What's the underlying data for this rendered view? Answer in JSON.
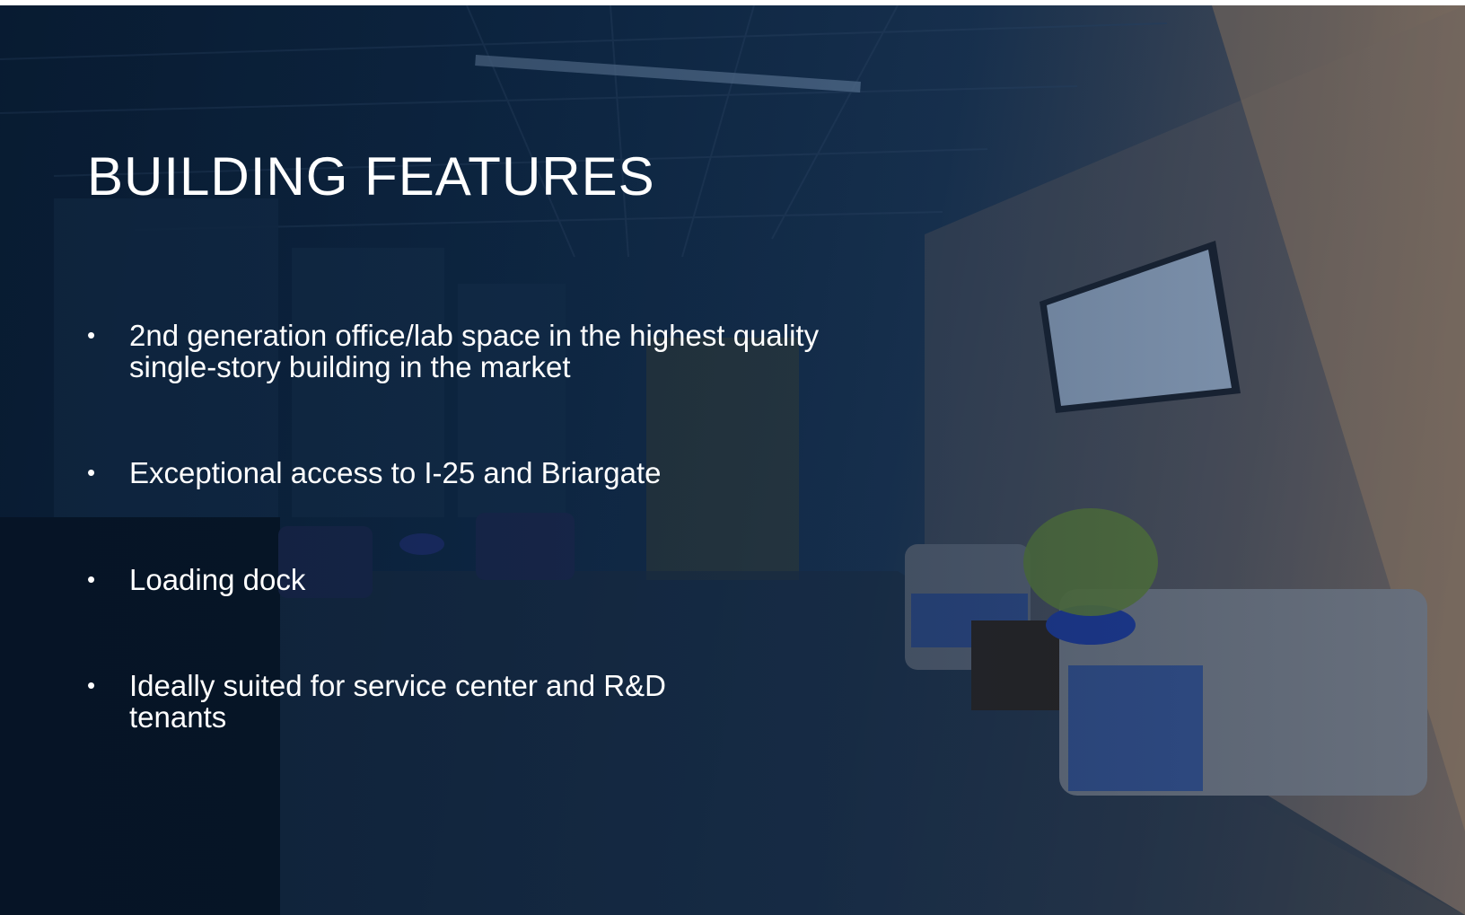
{
  "slide": {
    "title": "BUILDING FEATURES",
    "features": [
      "2nd generation office/lab space in the highest quality single-story building in the market",
      "Exceptional access to I-25 and Briargate",
      "Loading dock",
      "Ideally suited for service center and R&D tenants"
    ],
    "background": "photo of building lobby with seating, plant and wall-mounted TV",
    "colors": {
      "overlay": "#0f2a4a",
      "text": "#ffffff"
    }
  }
}
